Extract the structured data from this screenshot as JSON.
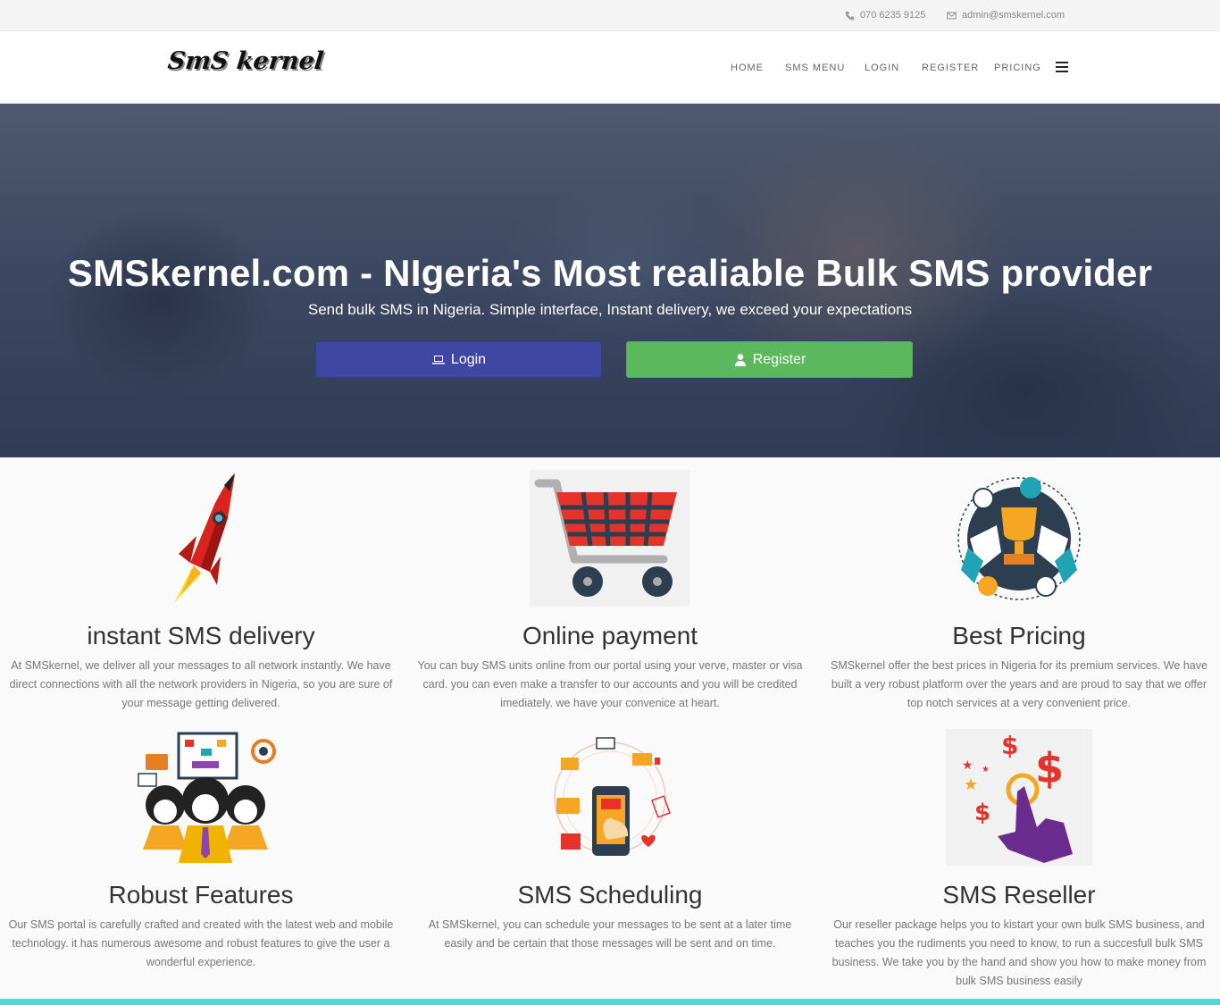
{
  "topbar": {
    "phone": "070 6235 9125",
    "email": "admin@smskernel.com"
  },
  "brand": {
    "logo_text": "SmS kernel"
  },
  "nav": {
    "items": [
      "HOME",
      "SMS MENU",
      "LOGIN",
      "REGISTER",
      "PRICING"
    ],
    "menu_icon": "hamburger-icon"
  },
  "hero": {
    "title": "SMSkernel.com - NIgeria's Most realiable Bulk SMS provider",
    "subtitle": "Send bulk SMS in Nigeria. Simple interface, Instant delivery, we exceed your expectations",
    "login_label": "Login",
    "register_label": "Register"
  },
  "features": [
    {
      "title": "instant SMS delivery",
      "icon": "rocket-icon",
      "text": "At SMSkernel, we deliver all your messages to all network instantly. We have direct connections with all the network providers in Nigeria, so you are sure of your message getting delivered."
    },
    {
      "title": "Online payment",
      "icon": "shopping-cart-icon",
      "text": "You can buy SMS units online from our portal using your verve, master or visa card. you can even make a transfer to our accounts and you will be credited imediately. we have your convenice at heart."
    },
    {
      "title": "Best Pricing",
      "icon": "trophy-icon",
      "text": "SMSkernel offer the best prices in Nigeria for its premium services. We have built a very robust platform over the years and are proud to say that we offer top notch services at a very convenient price."
    },
    {
      "title": "Robust Features",
      "icon": "team-presentation-icon",
      "text": "Our SMS portal is carefully crafted and created with the latest web and mobile technology. it has numerous awesome and robust features to give the user a wonderful experience."
    },
    {
      "title": "SMS Scheduling",
      "icon": "mobile-shopping-icon",
      "text": "At SMSkernel, you can schedule your messages to be sent at a later time easily and be certain that those messages will be sent and on time."
    },
    {
      "title": "SMS Reseller",
      "icon": "hand-dollar-icon",
      "text": "Our reseller package helps you to kistart your own bulk SMS business, and teaches you the rudiments you need to know, to run a succesfull bulk SMS business. We take you by the hand and show you how to make money from bulk SMS business easily"
    }
  ],
  "colors": {
    "login_button": "#3f47a2",
    "register_button": "#5cb85c",
    "bottom_bar": "#4dd9d6"
  }
}
